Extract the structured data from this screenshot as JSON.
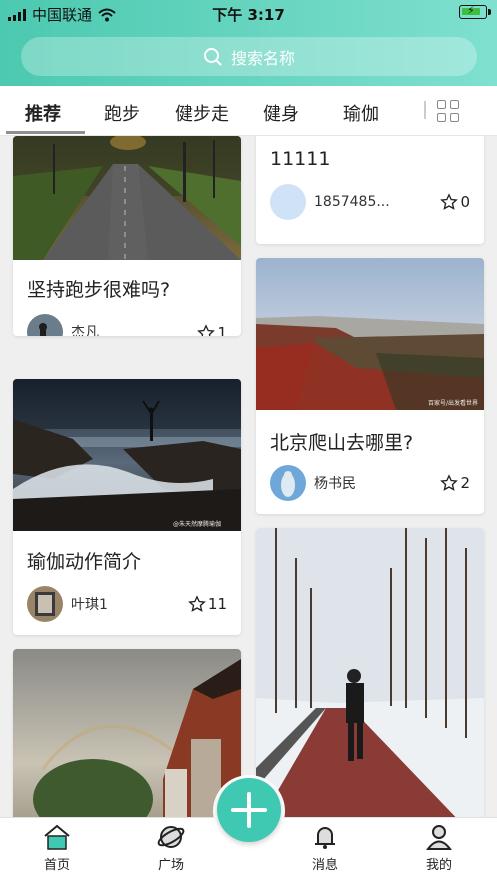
{
  "status_bar": {
    "carrier": "中国联通",
    "time": "下午 3:17"
  },
  "search": {
    "placeholder": "搜索名称"
  },
  "tabs": [
    {
      "label": "推荐",
      "active": true
    },
    {
      "label": "跑步"
    },
    {
      "label": "健步走"
    },
    {
      "label": "健身"
    },
    {
      "label": "瑜伽"
    }
  ],
  "feed": {
    "left": [
      {
        "title": "坚持跑步很难吗?",
        "user": "杰凡",
        "favorites": "1"
      },
      {
        "title": "瑜伽动作简介",
        "user": "叶琪1",
        "favorites": "11",
        "image_watermark": "@朱天然摩腾瑜伽"
      }
    ],
    "right": [
      {
        "title": "11111",
        "user": "1857485...",
        "favorites": "0"
      },
      {
        "title": "北京爬山去哪里?",
        "user": "杨书民",
        "favorites": "2",
        "image_watermark": "百家号/出发看世界"
      }
    ]
  },
  "bottom_nav": [
    {
      "label": "首页",
      "icon": "home-icon",
      "active": true
    },
    {
      "label": "广场",
      "icon": "planet-icon"
    },
    {
      "label": "消息",
      "icon": "bell-icon"
    },
    {
      "label": "我的",
      "icon": "user-icon"
    }
  ],
  "colors": {
    "accent": "#3fc9b2",
    "header_start": "#4cc9b0",
    "header_end": "#7fe0cf"
  }
}
